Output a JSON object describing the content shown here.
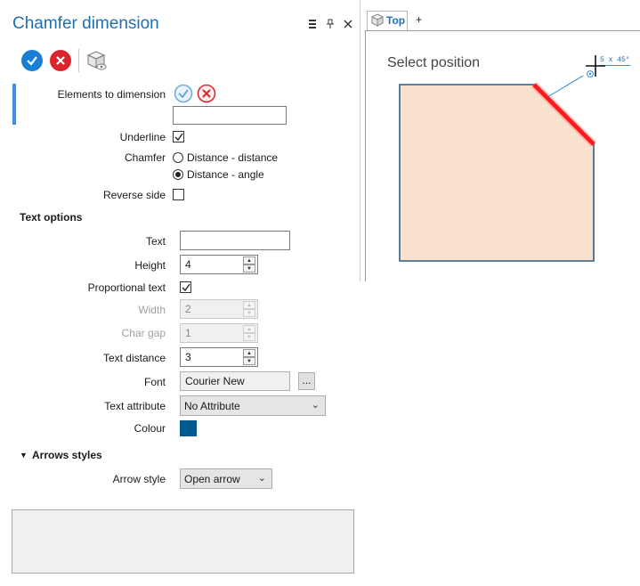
{
  "panel": {
    "title": "Chamfer dimension",
    "header_icons": [
      "menu-icon",
      "pin-icon",
      "close-icon"
    ],
    "toolbar": [
      "ok-check-icon",
      "cancel-x-icon",
      "preview-cube-icon"
    ]
  },
  "form": {
    "elements_label": "Elements to dimension",
    "elements_value": "",
    "underline": {
      "label": "Underline",
      "checked": true
    },
    "chamfer": {
      "label": "Chamfer",
      "options": [
        "Distance - distance",
        "Distance - angle"
      ],
      "selected": "Distance - angle"
    },
    "reverse_side": {
      "label": "Reverse side",
      "checked": false
    }
  },
  "text_options": {
    "section_title": "Text options",
    "text": {
      "label": "Text",
      "value": ""
    },
    "height": {
      "label": "Height",
      "value": "4"
    },
    "proportional_text": {
      "label": "Proportional text",
      "checked": true
    },
    "width": {
      "label": "Width",
      "value": "2"
    },
    "char_gap": {
      "label": "Char gap",
      "value": "1"
    },
    "text_distance": {
      "label": "Text distance",
      "value": "3"
    },
    "font": {
      "label": "Font",
      "value": "Courier New",
      "button": "..."
    },
    "text_attribute": {
      "label": "Text attribute",
      "value": "No Attribute"
    },
    "colour": {
      "label": "Colour",
      "color": "#005a8e"
    }
  },
  "arrows": {
    "section_title": "Arrows styles",
    "arrow_style": {
      "label": "Arrow style",
      "value": "Open arrow"
    }
  },
  "viewport": {
    "tab_label": "Top",
    "add_tab": "+",
    "prompt": "Select position",
    "dimension_preview": "5 x 45°",
    "shape_fill": "#f8e2cf",
    "highlight_color": "#ff0000"
  },
  "colors": {
    "accent": "#1f6fb5",
    "ok": "#1a7fd4",
    "cancel": "#d9262c",
    "left_bar": "#3b8fe0"
  }
}
